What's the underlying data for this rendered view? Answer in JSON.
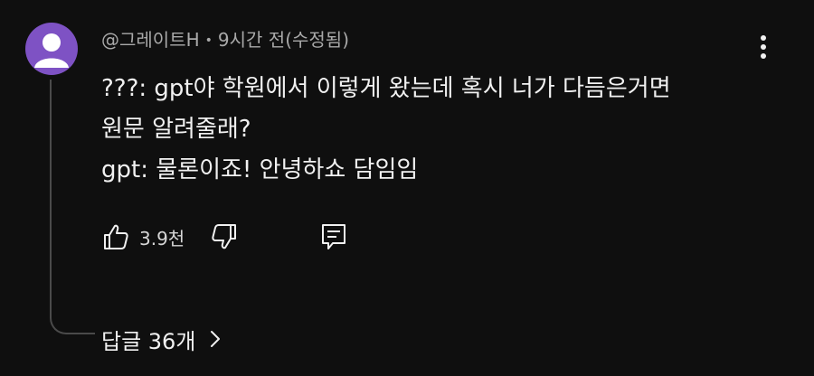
{
  "comment": {
    "author": "@그레이트H",
    "separator": "•",
    "time": "9시간 전(수정됨)",
    "lines": [
      "???: gpt야 학원에서 이렇게 왔는데 혹시 너가 다듬은거면",
      "원문 알려줄래?",
      "gpt: 물론이죠! 안녕하쇼 담임임"
    ],
    "like_count": "3.9천",
    "replies_label": "답글 36개"
  },
  "icons": {
    "avatar": "default-avatar-icon",
    "more": "more-vert-icon",
    "like": "thumbs-up-icon",
    "dislike": "thumbs-down-icon",
    "reply": "reply-comment-icon",
    "chevron": "chevron-right-icon"
  },
  "colors": {
    "background": "#0f0f0f",
    "avatar": "#7e52c4",
    "text": "#f1f1f1",
    "meta": "#a9a9a9"
  }
}
